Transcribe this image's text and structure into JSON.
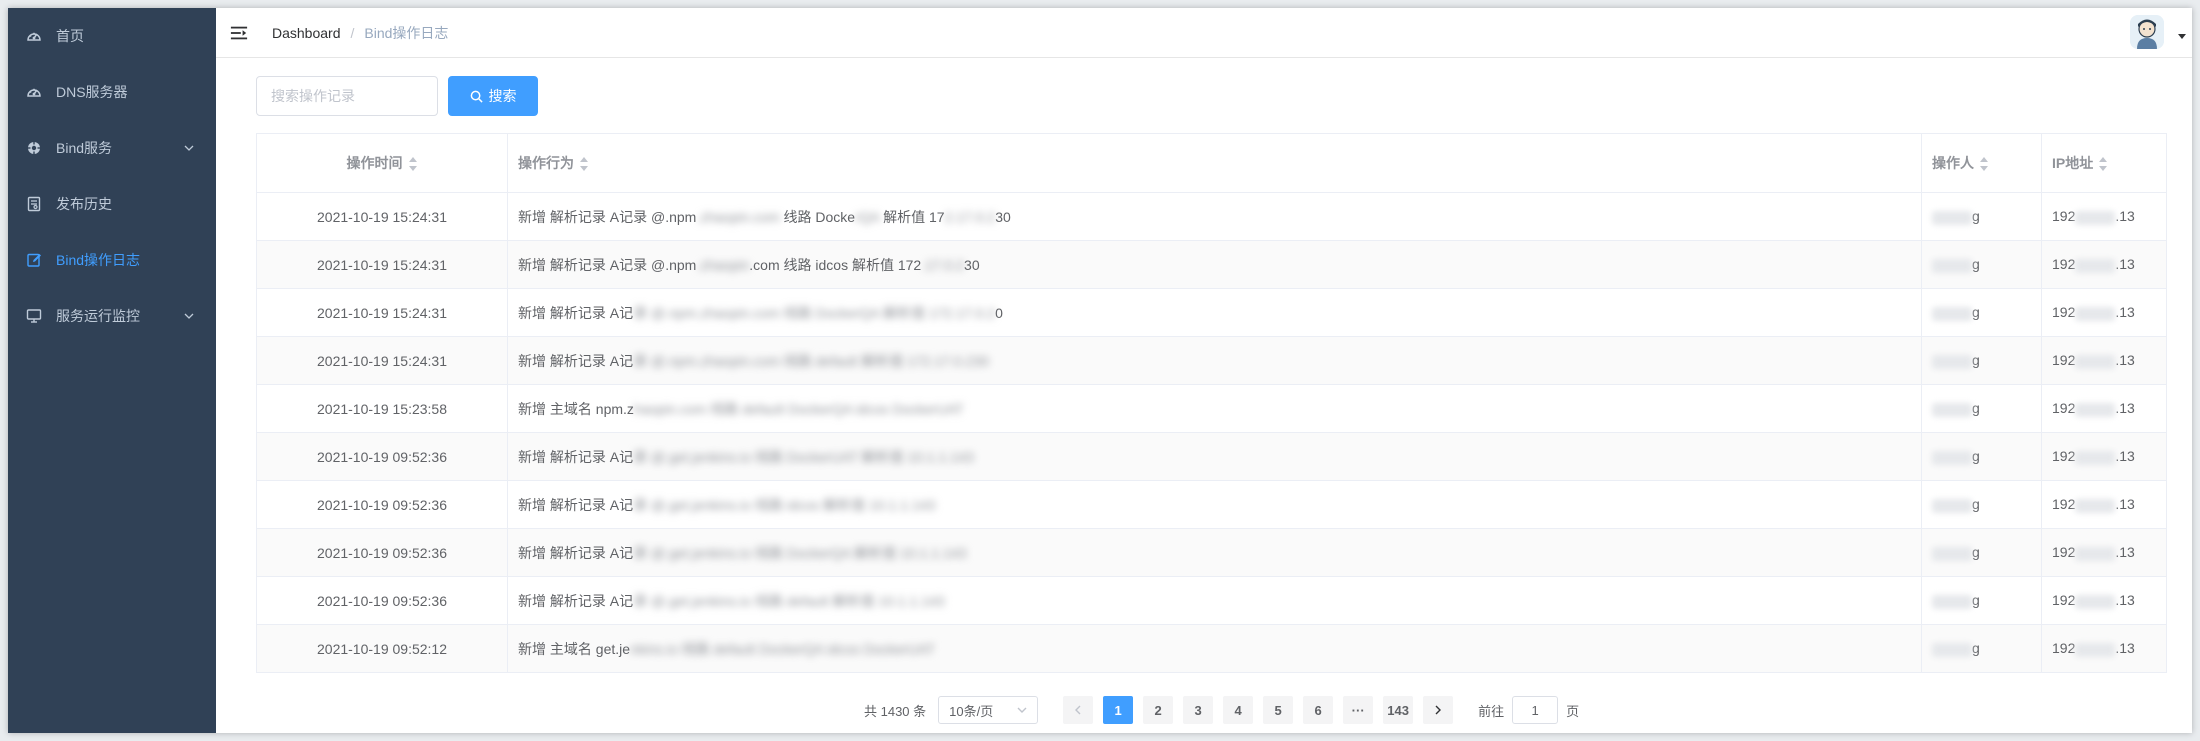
{
  "sidebar": {
    "items": [
      {
        "label": "首页",
        "icon": "dashboard-icon"
      },
      {
        "label": "DNS服务器",
        "icon": "dashboard-icon"
      },
      {
        "label": "Bind服务",
        "icon": "target-icon",
        "has_children": true
      },
      {
        "label": "发布历史",
        "icon": "document-icon"
      },
      {
        "label": "Bind操作日志",
        "icon": "edit-icon",
        "active": true
      },
      {
        "label": "服务运行监控",
        "icon": "monitor-icon",
        "has_children": true
      }
    ]
  },
  "header": {
    "breadcrumb": {
      "home": "Dashboard",
      "separator": "/",
      "current": "Bind操作日志"
    }
  },
  "search": {
    "placeholder": "搜索操作记录",
    "button_label": "搜索"
  },
  "table": {
    "columns": [
      "操作时间",
      "操作行为",
      "操作人",
      "IP地址"
    ],
    "rows": [
      {
        "time": "2021-10-19 15:24:31",
        "action_prefix": "新增 解析记录 A记录 @.npm",
        "action_blur": ".zhaopin.com",
        "action_suffix": " 线路 Docke",
        "action_blur2": "rQA",
        "action_suffix2": " 解析值 17",
        "action_blur3": "2.17.0.2",
        "action_suffix3": "30",
        "user_end": "g",
        "ip_start": "192",
        "ip_end": ".13"
      },
      {
        "time": "2021-10-19 15:24:31",
        "action_prefix": "新增 解析记录 A记录 @.npm",
        "action_blur": ".zhaopin",
        "action_suffix": ".com 线路 idcos 解析值 172",
        "action_blur2": ".17.0.2",
        "action_suffix2": "30",
        "action_blur3": "",
        "action_suffix3": "",
        "user_end": "g",
        "ip_start": "192",
        "ip_end": ".13"
      },
      {
        "time": "2021-10-19 15:24:31",
        "action_prefix": "新增 解析记录 A记",
        "action_blur": "录 @.npm.zhaopin.com 线路 DockerQA 解析值 172.17.0.2",
        "action_suffix": "0",
        "action_blur2": "",
        "action_suffix2": "",
        "action_blur3": "",
        "action_suffix3": "",
        "user_end": "g",
        "ip_start": "192",
        "ip_end": ".13"
      },
      {
        "time": "2021-10-19 15:24:31",
        "action_prefix": "新增 解析记录 A记",
        "action_blur": "录 @.npm.zhaopin.com 线路 default 解析值 172.17.0.230",
        "action_suffix": "",
        "action_blur2": "",
        "action_suffix2": "",
        "action_blur3": "",
        "action_suffix3": "",
        "user_end": "g",
        "ip_start": "192",
        "ip_end": ".13"
      },
      {
        "time": "2021-10-19 15:23:58",
        "action_prefix": "新增 主域名 npm.z",
        "action_blur": "haopin.com 线路 default DockerQA idcos DockerUAT",
        "action_suffix": "",
        "action_blur2": "",
        "action_suffix2": "",
        "action_blur3": "",
        "action_suffix3": "",
        "user_end": "g",
        "ip_start": "192",
        "ip_end": ".13"
      },
      {
        "time": "2021-10-19 09:52:36",
        "action_prefix": "新增 解析记录 A记",
        "action_blur": "录 @.get.jenkins.io 线路 DockerUAT 解析值 10.1.1.143",
        "action_suffix": "",
        "action_blur2": "",
        "action_suffix2": "",
        "action_blur3": "",
        "action_suffix3": "",
        "user_end": "g",
        "ip_start": "192",
        "ip_end": ".13"
      },
      {
        "time": "2021-10-19 09:52:36",
        "action_prefix": "新增 解析记录 A记",
        "action_blur": "录 @.get.jenkins.io 线路 idcos 解析值 10.1.1.143",
        "action_suffix": "",
        "action_blur2": "",
        "action_suffix2": "",
        "action_blur3": "",
        "action_suffix3": "",
        "user_end": "g",
        "ip_start": "192",
        "ip_end": ".13"
      },
      {
        "time": "2021-10-19 09:52:36",
        "action_prefix": "新增 解析记录 A记",
        "action_blur": "录 @.get.jenkins.io 线路 DockerQA 解析值 10.1.1.143",
        "action_suffix": "",
        "action_blur2": "",
        "action_suffix2": "",
        "action_blur3": "",
        "action_suffix3": "",
        "user_end": "g",
        "ip_start": "192",
        "ip_end": ".13"
      },
      {
        "time": "2021-10-19 09:52:36",
        "action_prefix": "新增 解析记录 A记",
        "action_blur": "录 @.get.jenkins.io 线路 default 解析值 10.1.1.143",
        "action_suffix": "",
        "action_blur2": "",
        "action_suffix2": "",
        "action_blur3": "",
        "action_suffix3": "",
        "user_end": "g",
        "ip_start": "192",
        "ip_end": ".13"
      },
      {
        "time": "2021-10-19 09:52:12",
        "action_prefix": "新增 主域名 get.je",
        "action_blur": "nkins.io 线路 default DockerQA idcos DockerUAT",
        "action_suffix": "",
        "action_blur2": "",
        "action_suffix2": "",
        "action_blur3": "",
        "action_suffix3": "",
        "user_end": "g",
        "ip_start": "192",
        "ip_end": ".13"
      }
    ]
  },
  "pagination": {
    "total_text": "共 1430 条",
    "page_size": "10条/页",
    "pages": [
      "1",
      "2",
      "3",
      "4",
      "5",
      "6",
      "···",
      "143"
    ],
    "current_page": "1",
    "jump_prefix": "前往",
    "jump_value": "1",
    "jump_suffix": "页"
  },
  "colors": {
    "sidebar_bg": "#304156",
    "sidebar_text": "#bfcbd9",
    "accent": "#409eff"
  }
}
